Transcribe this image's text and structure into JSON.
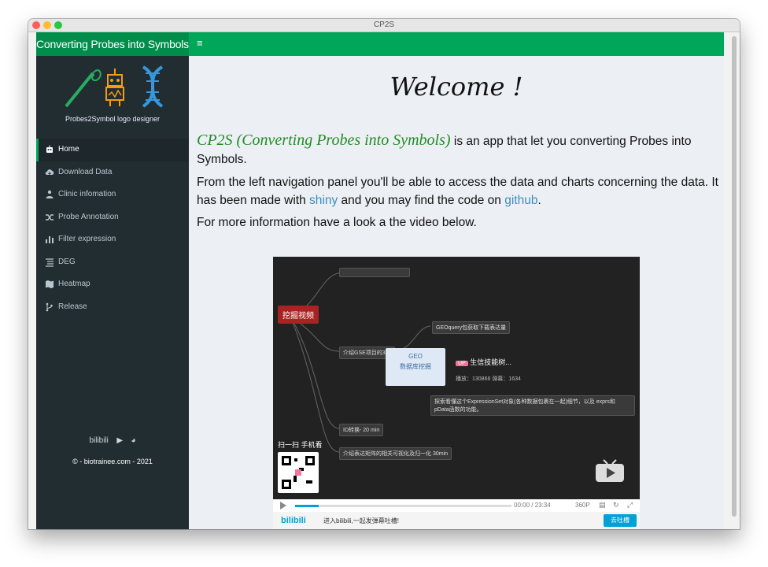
{
  "window": {
    "title": "CP2S"
  },
  "header": {
    "brand": "Converting Probes into Symbols",
    "toggle_icon": "hamburger-icon"
  },
  "sidebar": {
    "logo_caption": "Probes2Symbol logo designer",
    "items": [
      {
        "label": "Home",
        "icon": "robot-icon",
        "active": true
      },
      {
        "label": "Download Data",
        "icon": "cloud-download-icon",
        "active": false
      },
      {
        "label": "Clinic infomation",
        "icon": "user-md-icon",
        "active": false
      },
      {
        "label": "Probe Annotation",
        "icon": "random-icon",
        "active": false
      },
      {
        "label": "Filter expression",
        "icon": "bar-chart-icon",
        "active": false
      },
      {
        "label": "DEG",
        "icon": "list-icon",
        "active": false
      },
      {
        "label": "Heatmap",
        "icon": "map-icon",
        "active": false
      },
      {
        "label": "Release",
        "icon": "code-branch-icon",
        "active": false
      }
    ],
    "social": {
      "bilibili": "bilibili"
    },
    "copyright": "© - biotrainee.com - 2021"
  },
  "main": {
    "welcome": "Welcome !",
    "intro_title": "CP2S (Converting Probes into Symbols)",
    "intro_rest": " is an app that let you converting Probes into Symbols.",
    "p2_a": "From the left navigation panel you'll be able to access the data and charts concerning the data. It has been made with ",
    "p2_shiny": "shiny",
    "p2_b": " and you may find the code on ",
    "p2_github": "github",
    "p2_c": ".",
    "p3": "For more information have a look a the video below."
  },
  "video": {
    "node_red": "挖掘视频",
    "node_geoquery": "GEOquery包获取下载表达量",
    "node_intro_gse": "介绍GSE项目的3种",
    "node_id": "ID转换- 20 min",
    "node_norm": "介绍表达矩阵的相关可视化及归一化 30min",
    "node_expr": "探索看懂这个ExpressionSet对象(各种数据包裹在一起)细节，以及 exprs和 pData函数的功能。",
    "popup_title": "GEO",
    "popup_sub": "数据库挖掘",
    "up_badge": "UP",
    "up_name": "生信技能树...",
    "stats_views": "播放：130866",
    "stats_danmu": "弹幕：1634",
    "scan_text": "扫一扫 手机看",
    "time": "00:00 / 23:34",
    "resolution": "360P",
    "bili_logo": "bilibili",
    "danmu_placeholder": "进入bilibili,一起发弹幕吐槽!",
    "send_button": "去吐槽"
  },
  "colors": {
    "header": "#00a65a",
    "brand_bg": "#008d4c",
    "sidebar": "#222d32",
    "content_bg": "#ecf0f5",
    "link": "#3c8dbc",
    "title_green": "#228b22"
  }
}
